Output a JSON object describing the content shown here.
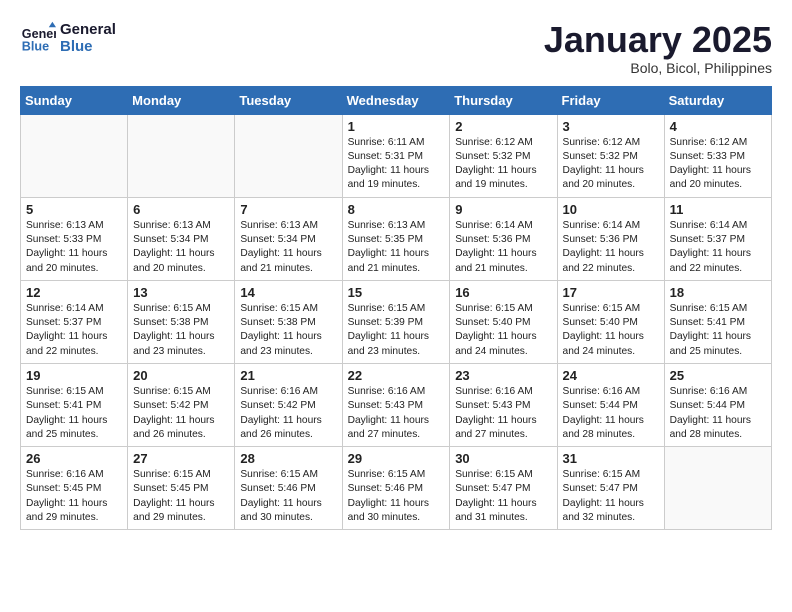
{
  "logo": {
    "line1": "General",
    "line2": "Blue"
  },
  "title": "January 2025",
  "location": "Bolo, Bicol, Philippines",
  "weekdays": [
    "Sunday",
    "Monday",
    "Tuesday",
    "Wednesday",
    "Thursday",
    "Friday",
    "Saturday"
  ],
  "weeks": [
    [
      {
        "day": "",
        "info": ""
      },
      {
        "day": "",
        "info": ""
      },
      {
        "day": "",
        "info": ""
      },
      {
        "day": "1",
        "info": "Sunrise: 6:11 AM\nSunset: 5:31 PM\nDaylight: 11 hours\nand 19 minutes."
      },
      {
        "day": "2",
        "info": "Sunrise: 6:12 AM\nSunset: 5:32 PM\nDaylight: 11 hours\nand 19 minutes."
      },
      {
        "day": "3",
        "info": "Sunrise: 6:12 AM\nSunset: 5:32 PM\nDaylight: 11 hours\nand 20 minutes."
      },
      {
        "day": "4",
        "info": "Sunrise: 6:12 AM\nSunset: 5:33 PM\nDaylight: 11 hours\nand 20 minutes."
      }
    ],
    [
      {
        "day": "5",
        "info": "Sunrise: 6:13 AM\nSunset: 5:33 PM\nDaylight: 11 hours\nand 20 minutes."
      },
      {
        "day": "6",
        "info": "Sunrise: 6:13 AM\nSunset: 5:34 PM\nDaylight: 11 hours\nand 20 minutes."
      },
      {
        "day": "7",
        "info": "Sunrise: 6:13 AM\nSunset: 5:34 PM\nDaylight: 11 hours\nand 21 minutes."
      },
      {
        "day": "8",
        "info": "Sunrise: 6:13 AM\nSunset: 5:35 PM\nDaylight: 11 hours\nand 21 minutes."
      },
      {
        "day": "9",
        "info": "Sunrise: 6:14 AM\nSunset: 5:36 PM\nDaylight: 11 hours\nand 21 minutes."
      },
      {
        "day": "10",
        "info": "Sunrise: 6:14 AM\nSunset: 5:36 PM\nDaylight: 11 hours\nand 22 minutes."
      },
      {
        "day": "11",
        "info": "Sunrise: 6:14 AM\nSunset: 5:37 PM\nDaylight: 11 hours\nand 22 minutes."
      }
    ],
    [
      {
        "day": "12",
        "info": "Sunrise: 6:14 AM\nSunset: 5:37 PM\nDaylight: 11 hours\nand 22 minutes."
      },
      {
        "day": "13",
        "info": "Sunrise: 6:15 AM\nSunset: 5:38 PM\nDaylight: 11 hours\nand 23 minutes."
      },
      {
        "day": "14",
        "info": "Sunrise: 6:15 AM\nSunset: 5:38 PM\nDaylight: 11 hours\nand 23 minutes."
      },
      {
        "day": "15",
        "info": "Sunrise: 6:15 AM\nSunset: 5:39 PM\nDaylight: 11 hours\nand 23 minutes."
      },
      {
        "day": "16",
        "info": "Sunrise: 6:15 AM\nSunset: 5:40 PM\nDaylight: 11 hours\nand 24 minutes."
      },
      {
        "day": "17",
        "info": "Sunrise: 6:15 AM\nSunset: 5:40 PM\nDaylight: 11 hours\nand 24 minutes."
      },
      {
        "day": "18",
        "info": "Sunrise: 6:15 AM\nSunset: 5:41 PM\nDaylight: 11 hours\nand 25 minutes."
      }
    ],
    [
      {
        "day": "19",
        "info": "Sunrise: 6:15 AM\nSunset: 5:41 PM\nDaylight: 11 hours\nand 25 minutes."
      },
      {
        "day": "20",
        "info": "Sunrise: 6:15 AM\nSunset: 5:42 PM\nDaylight: 11 hours\nand 26 minutes."
      },
      {
        "day": "21",
        "info": "Sunrise: 6:16 AM\nSunset: 5:42 PM\nDaylight: 11 hours\nand 26 minutes."
      },
      {
        "day": "22",
        "info": "Sunrise: 6:16 AM\nSunset: 5:43 PM\nDaylight: 11 hours\nand 27 minutes."
      },
      {
        "day": "23",
        "info": "Sunrise: 6:16 AM\nSunset: 5:43 PM\nDaylight: 11 hours\nand 27 minutes."
      },
      {
        "day": "24",
        "info": "Sunrise: 6:16 AM\nSunset: 5:44 PM\nDaylight: 11 hours\nand 28 minutes."
      },
      {
        "day": "25",
        "info": "Sunrise: 6:16 AM\nSunset: 5:44 PM\nDaylight: 11 hours\nand 28 minutes."
      }
    ],
    [
      {
        "day": "26",
        "info": "Sunrise: 6:16 AM\nSunset: 5:45 PM\nDaylight: 11 hours\nand 29 minutes."
      },
      {
        "day": "27",
        "info": "Sunrise: 6:15 AM\nSunset: 5:45 PM\nDaylight: 11 hours\nand 29 minutes."
      },
      {
        "day": "28",
        "info": "Sunrise: 6:15 AM\nSunset: 5:46 PM\nDaylight: 11 hours\nand 30 minutes."
      },
      {
        "day": "29",
        "info": "Sunrise: 6:15 AM\nSunset: 5:46 PM\nDaylight: 11 hours\nand 30 minutes."
      },
      {
        "day": "30",
        "info": "Sunrise: 6:15 AM\nSunset: 5:47 PM\nDaylight: 11 hours\nand 31 minutes."
      },
      {
        "day": "31",
        "info": "Sunrise: 6:15 AM\nSunset: 5:47 PM\nDaylight: 11 hours\nand 32 minutes."
      },
      {
        "day": "",
        "info": ""
      }
    ]
  ]
}
